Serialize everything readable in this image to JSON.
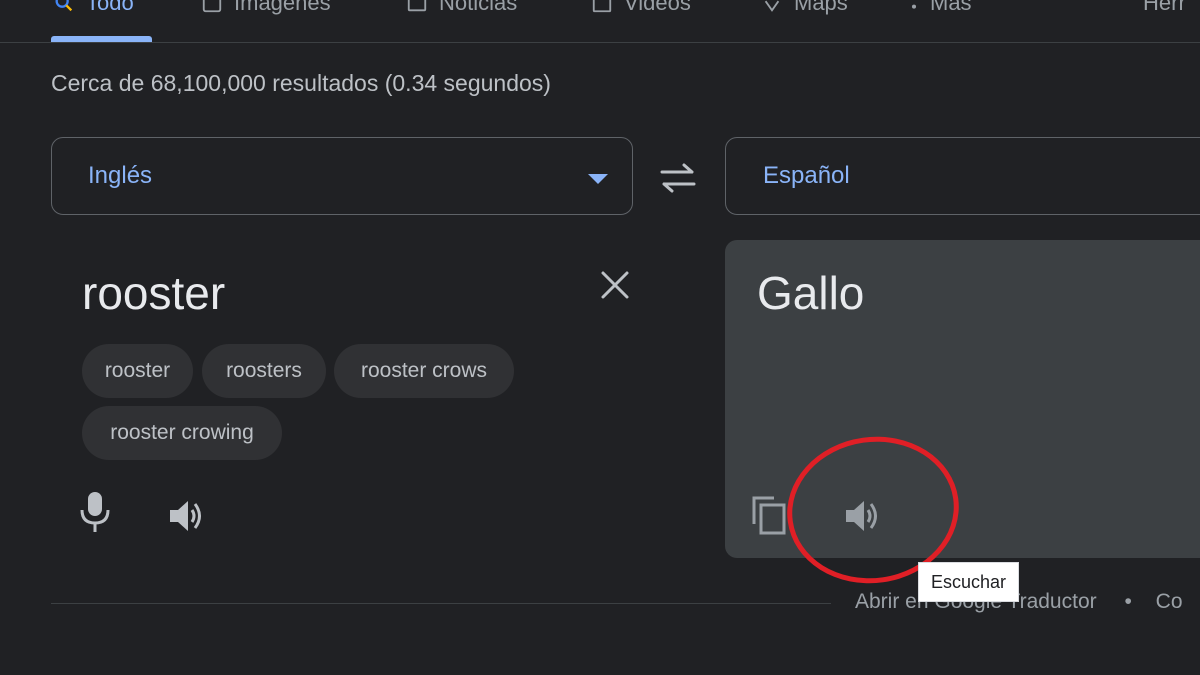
{
  "tabs": [
    {
      "label": "Todo",
      "icon": "search-icon"
    },
    {
      "label": "Imágenes",
      "icon": "image-icon"
    },
    {
      "label": "Noticias",
      "icon": "news-icon"
    },
    {
      "label": "Videos",
      "icon": "video-icon"
    },
    {
      "label": "Maps",
      "icon": "map-pin-icon"
    },
    {
      "label": "Más",
      "icon": "more-vert-icon"
    },
    {
      "label": "Herr"
    }
  ],
  "stats": "Cerca de 68,100,000 resultados (0.34 segundos)",
  "translator": {
    "source_lang": "Inglés",
    "target_lang": "Español",
    "source_text": "rooster",
    "target_text": "Gallo",
    "suggestions": [
      "rooster",
      "roosters",
      "rooster crows",
      "rooster crowing"
    ],
    "tooltip": "Escuchar"
  },
  "footer": {
    "open_link": "Abrir en Google Traductor",
    "separator": "•",
    "next_link": "Co"
  },
  "colors": {
    "accent": "#8ab4f8",
    "highlight_circle": "#e01f26",
    "background": "#202124"
  }
}
